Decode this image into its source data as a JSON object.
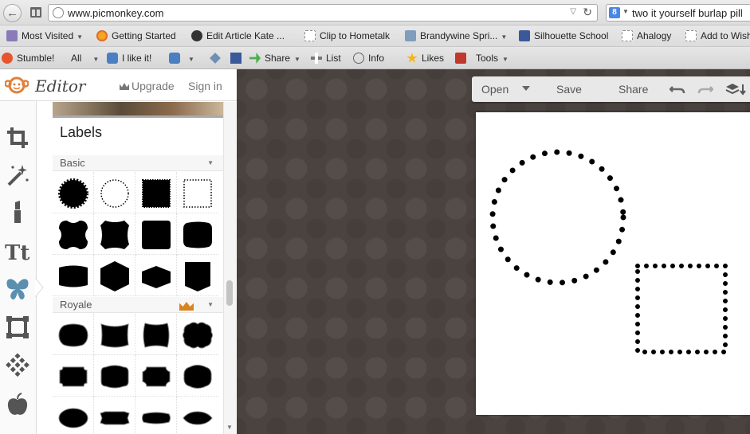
{
  "browser": {
    "url": "www.picmonkey.com",
    "search": "two it yourself burlap pill",
    "search_engine_badge": "8"
  },
  "bookmarks": [
    {
      "label": "Most Visited",
      "icon": "most-visited-icon",
      "dropdown": true
    },
    {
      "label": "Getting Started",
      "icon": "firefox-icon",
      "dropdown": false
    },
    {
      "label": "Edit Article Kate ...",
      "icon": "site-icon",
      "dropdown": false
    },
    {
      "label": "Clip to Hometalk",
      "icon": "page-icon",
      "dropdown": false
    },
    {
      "label": "Brandywine Spri...",
      "icon": "folder-icon",
      "dropdown": true
    },
    {
      "label": "Silhouette School",
      "icon": "facebook-icon",
      "dropdown": false
    },
    {
      "label": "Ahalogy",
      "icon": "page-icon",
      "dropdown": false
    },
    {
      "label": "Add to Wish",
      "icon": "page-icon",
      "dropdown": false
    }
  ],
  "stumble_toolbar": {
    "stumble": "Stumble!",
    "all": "All",
    "like": "I like it!",
    "share": "Share",
    "list": "List",
    "info": "Info",
    "likes": "Likes",
    "tools": "Tools"
  },
  "editor": {
    "title": "Editor",
    "upgrade": "Upgrade",
    "signin": "Sign in"
  },
  "rail_tools": [
    "crop-icon",
    "magic-wand-icon",
    "lipstick-icon",
    "text-icon",
    "butterfly-icon",
    "frame-icon",
    "texture-icon",
    "apple-icon"
  ],
  "panel": {
    "title": "Labels",
    "sections": [
      {
        "name": "Basic",
        "premium": false
      },
      {
        "name": "Royale",
        "premium": true
      }
    ]
  },
  "workspace": {
    "open": "Open",
    "save": "Save",
    "share": "Share",
    "icons": [
      "undo-icon",
      "redo-icon",
      "layers-icon"
    ]
  },
  "colors": {
    "workspace_bg": "#4b4340",
    "accent": "#d9831f",
    "logo": "#e0803a",
    "rail_icon": "#555555",
    "active_tool": "#5b8fb0"
  }
}
